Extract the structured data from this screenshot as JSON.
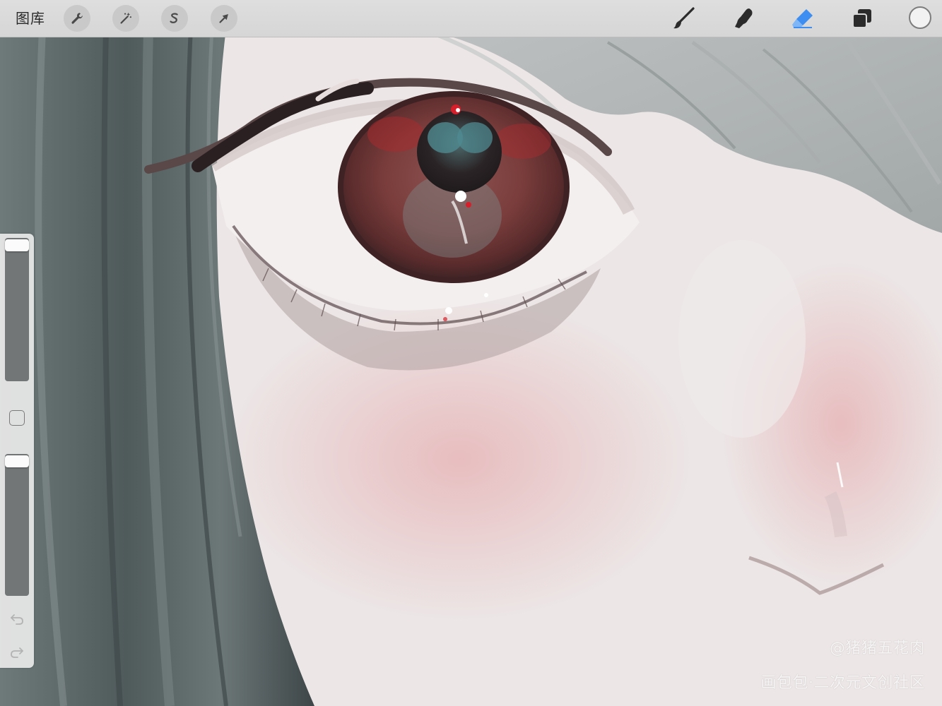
{
  "toolbar": {
    "gallery_label": "图库",
    "left_tools": [
      {
        "name": "actions",
        "icon": "wrench-icon"
      },
      {
        "name": "adjustments",
        "icon": "magic-wand-icon"
      },
      {
        "name": "selection",
        "icon": "selection-s-icon"
      },
      {
        "name": "transform",
        "icon": "arrow-cursor-icon"
      }
    ],
    "right_tools": [
      {
        "name": "brush",
        "icon": "brush-icon",
        "active": false
      },
      {
        "name": "smudge",
        "icon": "smudge-finger-icon",
        "active": false
      },
      {
        "name": "eraser",
        "icon": "eraser-icon",
        "active": true
      },
      {
        "name": "layers",
        "icon": "layers-icon",
        "active": false
      }
    ],
    "current_color": "#f2f2f2",
    "active_tool_color": "#3d8ef0"
  },
  "sidebar": {
    "brush_size_level": 1.0,
    "opacity_level": 1.0,
    "modify_button": "square-modify-icon",
    "undo_icon": "undo-icon",
    "redo_icon": "redo-icon"
  },
  "watermarks": {
    "artist": "@猪猪五花肉",
    "site": "画包包·二次元文创社区"
  }
}
